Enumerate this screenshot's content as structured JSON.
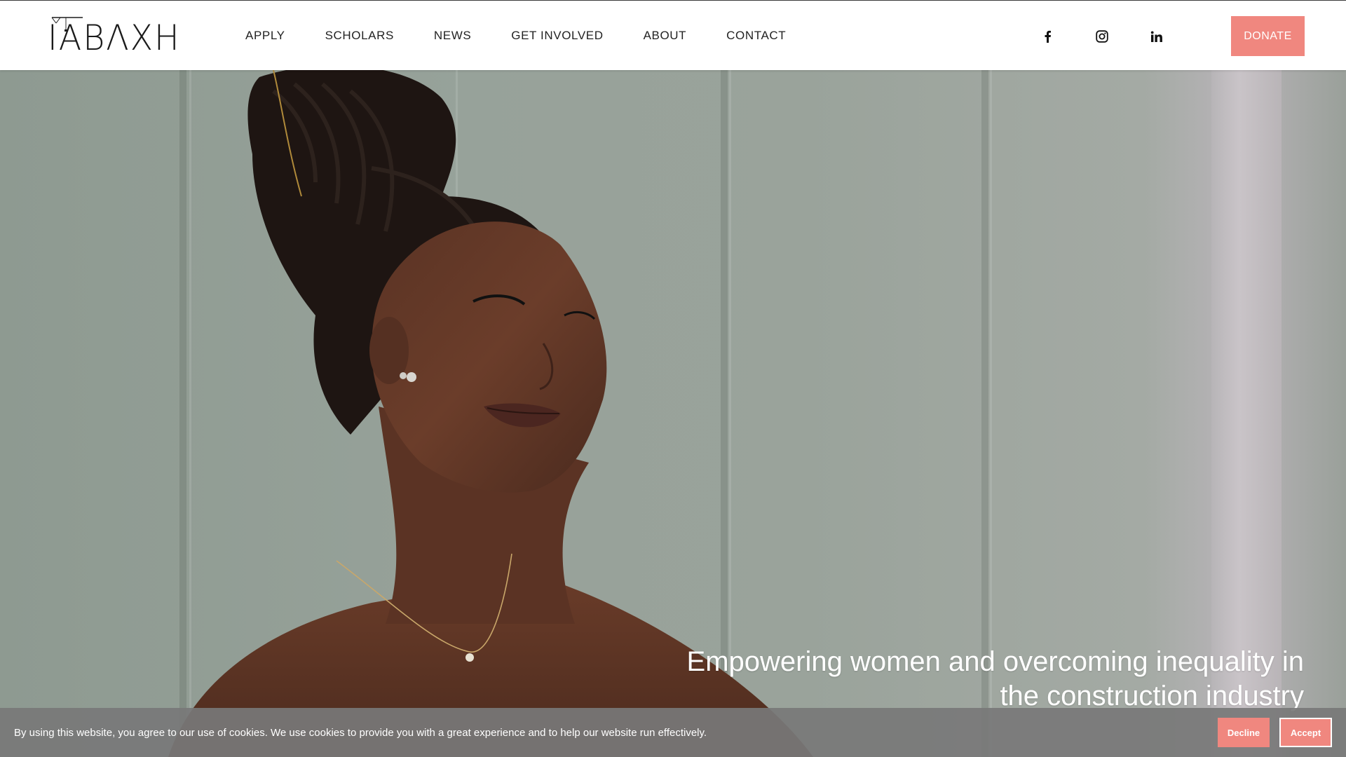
{
  "header": {
    "logo_text": "ΙΑΒΛΧΗ",
    "nav": [
      {
        "label": "APPLY"
      },
      {
        "label": "SCHOLARS"
      },
      {
        "label": "NEWS"
      },
      {
        "label": "GET INVOLVED"
      },
      {
        "label": "ABOUT"
      },
      {
        "label": "CONTACT"
      }
    ],
    "social": [
      {
        "icon": "facebook-icon"
      },
      {
        "icon": "instagram-icon"
      },
      {
        "icon": "linkedin-icon"
      }
    ],
    "donate_label": "DONATE"
  },
  "hero": {
    "heading_line1": "Empowering women and overcoming inequality in",
    "heading_line2": "the construction industry"
  },
  "cookie_bar": {
    "message": "By using this website, you agree to our use of cookies. We use cookies to provide you with a great experience and to help our website run effectively.",
    "decline_label": "Decline",
    "accept_label": "Accept"
  },
  "colors": {
    "accent": "#f0877f",
    "header_bg": "#ffffff",
    "cookie_bg": "#787878",
    "hero_bg": "#9aa39b"
  }
}
